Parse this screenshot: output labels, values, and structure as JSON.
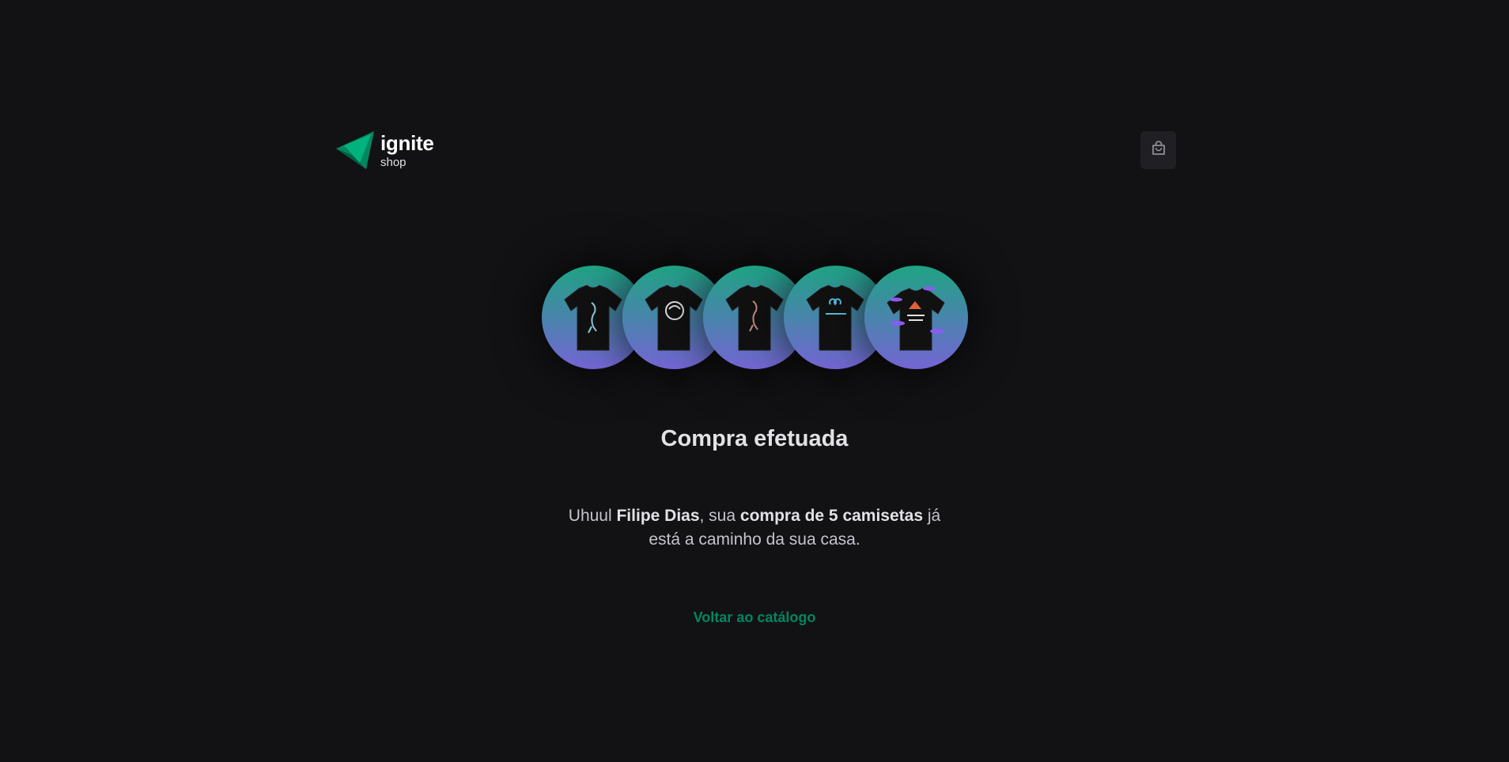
{
  "header": {
    "logo": {
      "brand": "ignite",
      "sub": "shop",
      "icon": "triangle-logo-icon"
    },
    "cart_icon": "shopping-bag-icon"
  },
  "success": {
    "shirts": [
      {
        "icon": "tshirt-icon"
      },
      {
        "icon": "tshirt-icon"
      },
      {
        "icon": "tshirt-icon"
      },
      {
        "icon": "tshirt-icon"
      },
      {
        "icon": "tshirt-icon"
      }
    ],
    "title": "Compra efetuada",
    "message": {
      "part1": "Uhuul ",
      "customer": "Filipe Dias",
      "part2": ", sua ",
      "purchase": "compra de 5 camisetas",
      "part3": " já está a caminho da sua casa."
    },
    "back_link": "Voltar ao catálogo"
  },
  "colors": {
    "background": "#121214",
    "accent": "#00875f",
    "gradient_start": "#1ea483",
    "gradient_end": "#7465d4"
  }
}
